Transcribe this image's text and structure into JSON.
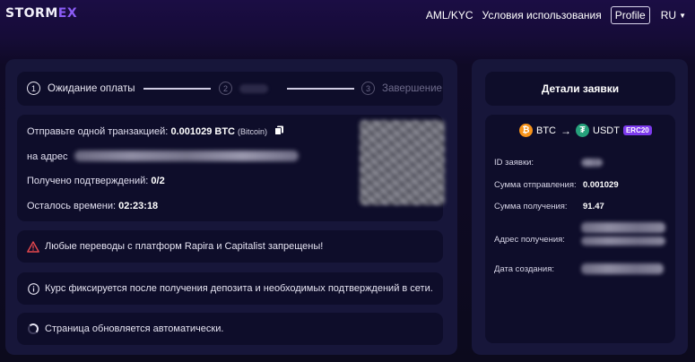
{
  "header": {
    "logo_main": "STORM",
    "logo_accent": "EX",
    "nav": {
      "aml": "AML/KYC",
      "terms": "Условия использования",
      "profile": "Profile",
      "lang": "RU"
    }
  },
  "stepper": {
    "steps": [
      {
        "num": "1",
        "label": "Ожидание оплаты",
        "active": true
      },
      {
        "num": "2",
        "label": "",
        "active": false
      },
      {
        "num": "3",
        "label": "Завершение",
        "active": false
      }
    ]
  },
  "payment": {
    "send_label": "Отправьте одной транзакцией:",
    "send_amount": "0.001029 BTC",
    "send_network": "(Bitcoin)",
    "address_label": "на адрес",
    "confirmations_label": "Получено подтверждений:",
    "confirmations_value": "0/2",
    "time_label": "Осталось времени:",
    "time_value": "02:23:18"
  },
  "notices": {
    "warning": "Любые переводы с платформ Rapira и Capitalist запрещены!",
    "info": "Курс фиксируется после получения депозита и необходимых подтверждений в сети.",
    "refresh": "Страница обновляется автоматически."
  },
  "details": {
    "title": "Детали заявки",
    "from_coin": "BTC",
    "to_coin": "USDT",
    "to_network": "ERC20",
    "order_id_label": "ID заявки:",
    "send_sum_label": "Сумма отправления:",
    "send_sum_value": "0.001029",
    "receive_sum_label": "Сумма получения:",
    "receive_sum_value": "91.47",
    "receive_address_label": "Адрес получения:",
    "created_label": "Дата создания:"
  },
  "colors": {
    "accent": "#8b5cf6",
    "badge": "#7c3aed",
    "btc": "#f7931a",
    "usdt": "#26a17b",
    "warning": "#e5484d"
  }
}
